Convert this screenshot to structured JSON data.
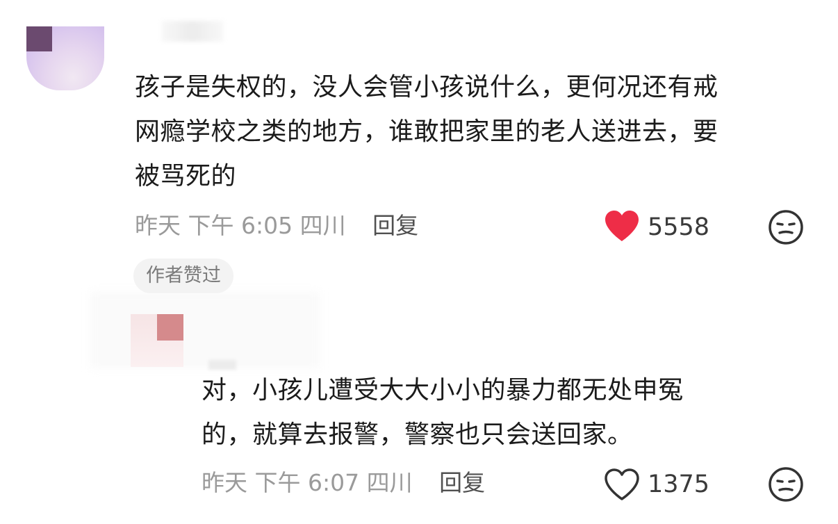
{
  "comment1": {
    "lines": [
      "孩子是失权的，没人会管小孩说什么，更何况还有戒",
      "网瘾学校之类的地方，谁敢把家里的老人送进去，要",
      "被骂死的"
    ],
    "time": "昨天 下午 6:05 四川",
    "reply": "回复",
    "likes": "5558",
    "liked": true,
    "badge": "作者赞过",
    "like_color": "#ee2d47"
  },
  "comment2": {
    "lines": [
      "对，小孩儿遭受大大小小的暴力都无处申冤",
      "的，就算去报警，警察也只会送回家。"
    ],
    "time": "昨天 下午 6:07 四川",
    "reply": "回复",
    "likes": "1375",
    "liked": false
  },
  "icons": {
    "like_filled": "heart-filled-icon",
    "like_outline": "heart-outline-icon",
    "dislike": "unhappy-face-icon"
  }
}
